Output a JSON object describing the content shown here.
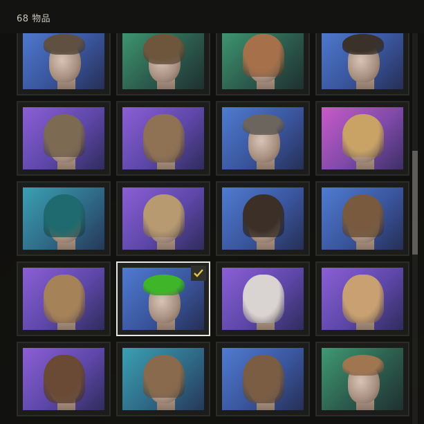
{
  "header": {
    "item_count": "68 物品"
  },
  "accent": "#e8c542",
  "items": [
    {
      "bg": "blue",
      "hair": "#5f5042",
      "style": "short",
      "selected": false
    },
    {
      "bg": "green",
      "hair": "#6e563d",
      "style": "",
      "selected": false
    },
    {
      "bg": "green",
      "hair": "#a5704a",
      "style": "bob",
      "selected": false
    },
    {
      "bg": "blue",
      "hair": "#3a312a",
      "style": "short",
      "selected": false
    },
    {
      "bg": "purple",
      "hair": "#7d6a52",
      "style": "bob",
      "selected": false
    },
    {
      "bg": "purple",
      "hair": "#8f7254",
      "style": "long",
      "selected": false
    },
    {
      "bg": "blue",
      "hair": "#6b655e",
      "style": "short",
      "selected": false
    },
    {
      "bg": "pink",
      "hair": "#c9a266",
      "style": "bob",
      "selected": false
    },
    {
      "bg": "teal",
      "hair": "#1f6a6e",
      "style": "bob",
      "selected": false
    },
    {
      "bg": "purple",
      "hair": "#b89a70",
      "style": "bob",
      "selected": false
    },
    {
      "bg": "blue",
      "hair": "#3b2f27",
      "style": "bob",
      "selected": false
    },
    {
      "bg": "blue",
      "hair": "#7a5a3f",
      "style": "bob",
      "selected": false
    },
    {
      "bg": "purple",
      "hair": "#a68259",
      "style": "long",
      "selected": false
    },
    {
      "bg": "blue",
      "hair": "#3fb52a",
      "style": "short",
      "selected": true
    },
    {
      "bg": "purple",
      "hair": "#d9d4d2",
      "style": "long",
      "selected": false
    },
    {
      "bg": "purple",
      "hair": "#c9a071",
      "style": "long",
      "selected": false
    },
    {
      "bg": "purple",
      "hair": "#6a4a34",
      "style": "long",
      "selected": false
    },
    {
      "bg": "teal",
      "hair": "#8a6a4c",
      "style": "bob",
      "selected": false
    },
    {
      "bg": "blue",
      "hair": "#7a5d43",
      "style": "long",
      "selected": false
    },
    {
      "bg": "green",
      "hair": "#a07650",
      "style": "short",
      "selected": false
    }
  ],
  "selected_indicator": "checkmark-icon"
}
